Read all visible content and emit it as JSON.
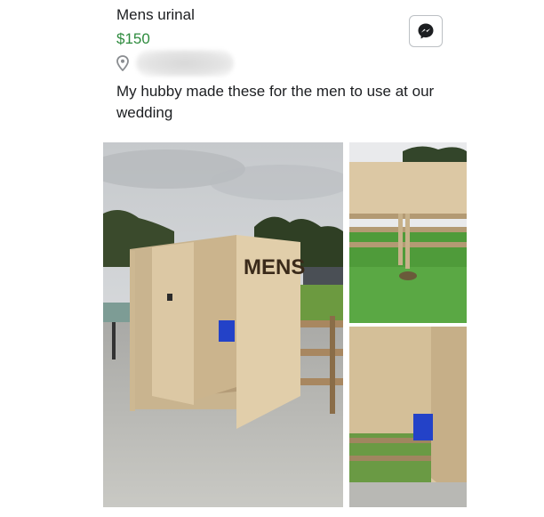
{
  "listing": {
    "title": "Mens urinal",
    "price": "$150",
    "description": "My hubby made these for the men to use at our wedding"
  },
  "icons": {
    "location": "location-pin-icon",
    "messenger": "messenger-icon"
  },
  "photos": {
    "main_sign_text": "MENS"
  },
  "colors": {
    "price": "#2e8b3e",
    "text": "#1c1e21",
    "plywood": "#dcc8a4",
    "chair": "#2342c8"
  }
}
